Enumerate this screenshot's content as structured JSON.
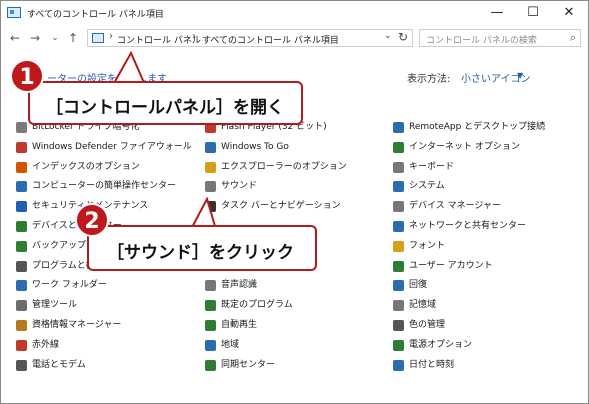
{
  "window": {
    "title": "すべてのコントロール パネル項目"
  },
  "window_buttons": {
    "minimize": "—",
    "maximize": "☐",
    "close": "✕"
  },
  "nav": {
    "back": "←",
    "forward": "→",
    "down": "⌄",
    "up": "↑"
  },
  "address": {
    "separator": "›",
    "crumbs": [
      "コントロール パネル",
      "すべてのコントロール パネル項目"
    ],
    "dropdown": "⌄",
    "refresh": "↻"
  },
  "search": {
    "placeholder": "コントロール パネルの検索"
  },
  "header": {
    "adjust_link": "ーターの設定を調整します",
    "view_by_label": "表示方法:",
    "view_by_value": "小さいアイコン",
    "view_by_caret": "▼"
  },
  "columns": {
    "left": [
      {
        "label": "BitLocker ドライブ暗号化",
        "color": "#7a7a7a"
      },
      {
        "label": "Windows Defender ファイアウォール",
        "color": "#c0392b"
      },
      {
        "label": "インデックスのオプション",
        "color": "#d35400"
      },
      {
        "label": "コンピューターの簡単操作センター",
        "color": "#2b6cb0"
      },
      {
        "label": "セキュリティとメンテナンス",
        "color": "#1f5fae"
      },
      {
        "label": "デバイスとプリンター",
        "color": "#2e7d32"
      },
      {
        "label": "バックアップと復元",
        "color": "#2e7d32"
      },
      {
        "label": "プログラムと機能",
        "color": "#555555"
      },
      {
        "label": "ワーク フォルダー",
        "color": "#2b6cb0"
      },
      {
        "label": "管理ツール",
        "color": "#6d6d6d"
      },
      {
        "label": "資格情報マネージャー",
        "color": "#b7791f"
      },
      {
        "label": "赤外線",
        "color": "#c0392b"
      },
      {
        "label": "電話とモデム",
        "color": "#555555"
      }
    ],
    "middle": [
      {
        "label": "Flash Player (32 ビット)",
        "color": "#c0392b"
      },
      {
        "label": "Windows To Go",
        "color": "#2b6cb0"
      },
      {
        "label": "エクスプローラーのオプション",
        "color": "#d4a017"
      },
      {
        "label": "サウンド",
        "color": "#777777"
      },
      {
        "label": "タスク バーとナビゲーション",
        "color": "#333333"
      },
      {
        "label": "",
        "color": "#ffffff"
      },
      {
        "label": "",
        "color": "#ffffff"
      },
      {
        "label": "",
        "color": "#ffffff"
      },
      {
        "label": "音声認識",
        "color": "#777777"
      },
      {
        "label": "既定のプログラム",
        "color": "#2e7d32"
      },
      {
        "label": "自動再生",
        "color": "#2e7d32"
      },
      {
        "label": "地域",
        "color": "#2b6cb0"
      },
      {
        "label": "同期センター",
        "color": "#2e7d32"
      }
    ],
    "right": [
      {
        "label": "RemoteApp とデスクトップ接続",
        "color": "#2b6cb0"
      },
      {
        "label": "インターネット オプション",
        "color": "#2e7d32"
      },
      {
        "label": "キーボード",
        "color": "#777777"
      },
      {
        "label": "システム",
        "color": "#2b6cb0"
      },
      {
        "label": "デバイス マネージャー",
        "color": "#777777"
      },
      {
        "label": "ネットワークと共有センター",
        "color": "#2b6cb0"
      },
      {
        "label": "フォント",
        "color": "#d4a017"
      },
      {
        "label": "ユーザー アカウント",
        "color": "#2e7d32"
      },
      {
        "label": "回復",
        "color": "#2b6cb0"
      },
      {
        "label": "記憶域",
        "color": "#777777"
      },
      {
        "label": "色の管理",
        "color": "#555555"
      },
      {
        "label": "電源オプション",
        "color": "#2e7d32"
      },
      {
        "label": "日付と時刻",
        "color": "#2b6cb0"
      }
    ]
  },
  "callouts": [
    {
      "number": "1",
      "text": "［コントロールパネル］を開く"
    },
    {
      "number": "2",
      "text": "［サウンド］をクリック"
    }
  ],
  "colors": {
    "callout_border": "#b01b1b",
    "badge": "#c0171b",
    "link": "#1f5fae"
  }
}
